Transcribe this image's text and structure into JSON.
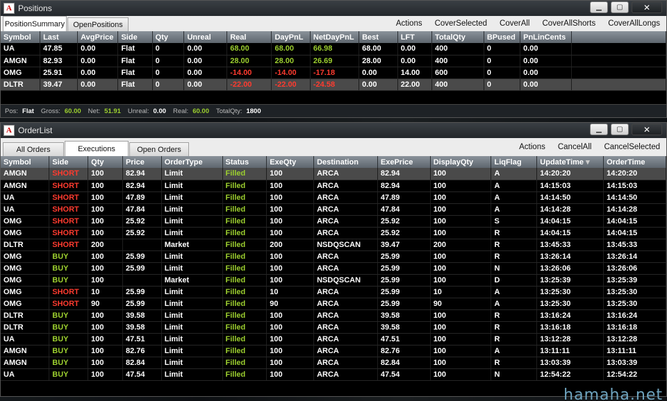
{
  "positions_window": {
    "title": "Positions",
    "tabs": [
      "PositionSummary",
      "OpenPositions"
    ],
    "actions": [
      "Actions",
      "CoverSelected",
      "CoverAll",
      "CoverAllShorts",
      "CoverAllLongs"
    ],
    "columns": [
      "Symbol",
      "Last",
      "AvgPrice",
      "Side",
      "Qty",
      "Unreal",
      "Real",
      "DayPnL",
      "NetDayPnL",
      "Best",
      "LFT",
      "TotalQty",
      "BPused",
      "PnLinCents"
    ],
    "rows": [
      [
        "UA",
        "47.85",
        "0.00",
        "Flat",
        "0",
        "0.00",
        "68.00",
        "68.00",
        "66.98",
        "68.00",
        "0.00",
        "400",
        "0",
        "0.00"
      ],
      [
        "AMGN",
        "82.93",
        "0.00",
        "Flat",
        "0",
        "0.00",
        "28.00",
        "28.00",
        "26.69",
        "28.00",
        "0.00",
        "400",
        "0",
        "0.00"
      ],
      [
        "OMG",
        "25.91",
        "0.00",
        "Flat",
        "0",
        "0.00",
        "-14.00",
        "-14.00",
        "-17.18",
        "0.00",
        "14.00",
        "600",
        "0",
        "0.00"
      ],
      [
        "DLTR",
        "39.47",
        "0.00",
        "Flat",
        "0",
        "0.00",
        "-22.00",
        "-22.00",
        "-24.58",
        "0.00",
        "22.00",
        "400",
        "0",
        "0.00"
      ]
    ],
    "status": {
      "pos_label": "Pos:",
      "pos": "Flat",
      "gross_label": "Gross:",
      "gross": "60.00",
      "net_label": "Net:",
      "net": "51.91",
      "unreal_label": "Unreal:",
      "unreal": "0.00",
      "real_label": "Real:",
      "real": "60.00",
      "totalqty_label": "TotalQty:",
      "totalqty": "1800"
    }
  },
  "orderlist_window": {
    "title": "OrderList",
    "tabs": [
      "All Orders",
      "Executions",
      "Open Orders"
    ],
    "actions": [
      "Actions",
      "CancelAll",
      "CancelSelected"
    ],
    "columns": [
      "Symbol",
      "Side",
      "Qty",
      "Price",
      "OrderType",
      "Status",
      "ExeQty",
      "Destination",
      "ExePrice",
      "DisplayQty",
      "LiqFlag",
      "UpdateTime",
      "OrderTime"
    ],
    "rows": [
      [
        "AMGN",
        "SHORT",
        "100",
        "82.94",
        "Limit",
        "Filled",
        "100",
        "ARCA",
        "82.94",
        "100",
        "A",
        "14:20:20",
        "14:20:20"
      ],
      [
        "AMGN",
        "SHORT",
        "100",
        "82.94",
        "Limit",
        "Filled",
        "100",
        "ARCA",
        "82.94",
        "100",
        "A",
        "14:15:03",
        "14:15:03"
      ],
      [
        "UA",
        "SHORT",
        "100",
        "47.89",
        "Limit",
        "Filled",
        "100",
        "ARCA",
        "47.89",
        "100",
        "A",
        "14:14:50",
        "14:14:50"
      ],
      [
        "UA",
        "SHORT",
        "100",
        "47.84",
        "Limit",
        "Filled",
        "100",
        "ARCA",
        "47.84",
        "100",
        "A",
        "14:14:28",
        "14:14:28"
      ],
      [
        "OMG",
        "SHORT",
        "100",
        "25.92",
        "Limit",
        "Filled",
        "100",
        "ARCA",
        "25.92",
        "100",
        "S",
        "14:04:15",
        "14:04:15"
      ],
      [
        "OMG",
        "SHORT",
        "100",
        "25.92",
        "Limit",
        "Filled",
        "100",
        "ARCA",
        "25.92",
        "100",
        "R",
        "14:04:15",
        "14:04:15"
      ],
      [
        "DLTR",
        "SHORT",
        "200",
        "",
        "Market",
        "Filled",
        "200",
        "NSDQSCAN",
        "39.47",
        "200",
        "R",
        "13:45:33",
        "13:45:33"
      ],
      [
        "OMG",
        "BUY",
        "100",
        "25.99",
        "Limit",
        "Filled",
        "100",
        "ARCA",
        "25.99",
        "100",
        "R",
        "13:26:14",
        "13:26:14"
      ],
      [
        "OMG",
        "BUY",
        "100",
        "25.99",
        "Limit",
        "Filled",
        "100",
        "ARCA",
        "25.99",
        "100",
        "N",
        "13:26:06",
        "13:26:06"
      ],
      [
        "OMG",
        "BUY",
        "100",
        "",
        "Market",
        "Filled",
        "100",
        "NSDQSCAN",
        "25.99",
        "100",
        "D",
        "13:25:39",
        "13:25:39"
      ],
      [
        "OMG",
        "SHORT",
        "10",
        "25.99",
        "Limit",
        "Filled",
        "10",
        "ARCA",
        "25.99",
        "10",
        "A",
        "13:25:30",
        "13:25:30"
      ],
      [
        "OMG",
        "SHORT",
        "90",
        "25.99",
        "Limit",
        "Filled",
        "90",
        "ARCA",
        "25.99",
        "90",
        "A",
        "13:25:30",
        "13:25:30"
      ],
      [
        "DLTR",
        "BUY",
        "100",
        "39.58",
        "Limit",
        "Filled",
        "100",
        "ARCA",
        "39.58",
        "100",
        "R",
        "13:16:24",
        "13:16:24"
      ],
      [
        "DLTR",
        "BUY",
        "100",
        "39.58",
        "Limit",
        "Filled",
        "100",
        "ARCA",
        "39.58",
        "100",
        "R",
        "13:16:18",
        "13:16:18"
      ],
      [
        "UA",
        "BUY",
        "100",
        "47.51",
        "Limit",
        "Filled",
        "100",
        "ARCA",
        "47.51",
        "100",
        "R",
        "13:12:28",
        "13:12:28"
      ],
      [
        "AMGN",
        "BUY",
        "100",
        "82.76",
        "Limit",
        "Filled",
        "100",
        "ARCA",
        "82.76",
        "100",
        "A",
        "13:11:11",
        "13:11:11"
      ],
      [
        "AMGN",
        "BUY",
        "100",
        "82.84",
        "Limit",
        "Filled",
        "100",
        "ARCA",
        "82.84",
        "100",
        "R",
        "13:03:39",
        "13:03:39"
      ],
      [
        "UA",
        "BUY",
        "100",
        "47.54",
        "Limit",
        "Filled",
        "100",
        "ARCA",
        "47.54",
        "100",
        "N",
        "12:54:22",
        "12:54:22"
      ]
    ]
  },
  "watermark": "hamaha.net",
  "colors": {
    "positive": "#9ccf2f",
    "negative": "#ff3b2f",
    "header": "#6b737b"
  }
}
